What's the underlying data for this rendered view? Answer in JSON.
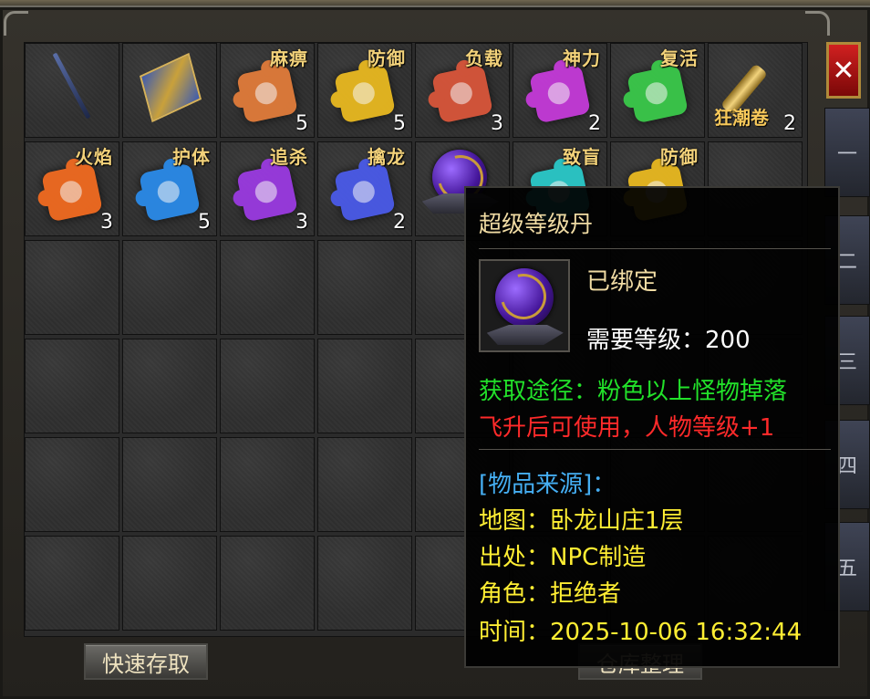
{
  "window": {
    "close_label": "✕"
  },
  "inventory": {
    "slots": [
      {
        "kind": "sword",
        "name": "sword-item",
        "label": "",
        "count": ""
      },
      {
        "kind": "banner",
        "name": "banner-item",
        "label": "",
        "count": ""
      },
      {
        "kind": "piece",
        "name": "puzzle-paralysis",
        "label": "麻痹",
        "count": "5",
        "color": "#e07b3a"
      },
      {
        "kind": "piece",
        "name": "puzzle-defense",
        "label": "防御",
        "count": "5",
        "color": "#e8b820"
      },
      {
        "kind": "piece",
        "name": "puzzle-load",
        "label": "负载",
        "count": "3",
        "color": "#d8553a"
      },
      {
        "kind": "piece",
        "name": "puzzle-divine-power",
        "label": "神力",
        "count": "2",
        "color": "#c43ad8"
      },
      {
        "kind": "piece",
        "name": "puzzle-revive",
        "label": "复活",
        "count": "",
        "color": "#3ac84a"
      },
      {
        "kind": "scroll",
        "name": "frenzy-scroll",
        "label": "狂潮卷",
        "count": "2"
      },
      {
        "kind": "piece",
        "name": "puzzle-flame",
        "label": "火焰",
        "count": "3",
        "color": "#f06a20"
      },
      {
        "kind": "piece",
        "name": "puzzle-guard",
        "label": "护体",
        "count": "5",
        "color": "#2a8ae8"
      },
      {
        "kind": "piece",
        "name": "puzzle-pursuit",
        "label": "追杀",
        "count": "3",
        "color": "#9a3ae0"
      },
      {
        "kind": "piece",
        "name": "puzzle-dragon",
        "label": "擒龙",
        "count": "2",
        "color": "#4a5ae8"
      },
      {
        "kind": "orb",
        "name": "super-level-pill",
        "label": "",
        "count": ""
      },
      {
        "kind": "piece",
        "name": "puzzle-blind",
        "label": "致盲",
        "count": "",
        "color": "#2ac8c8"
      },
      {
        "kind": "piece",
        "name": "puzzle-defense-2",
        "label": "防御",
        "count": "",
        "color": "#e8b820"
      }
    ]
  },
  "buttons": {
    "quick_access": "快速存取",
    "sort_storage": "仓库整理"
  },
  "side_tabs": [
    "一",
    "二",
    "三",
    "四",
    "五"
  ],
  "tooltip": {
    "title": "超级等级丹",
    "bound": "已绑定",
    "level_req": "需要等级：200",
    "obtain": "获取途径：粉色以上怪物掉落",
    "usage": "飞升后可使用，人物等级+1",
    "source_header": "[物品来源]：",
    "map": "地图：卧龙山庄1层",
    "origin": "出处：NPC制造",
    "role": "角色：拒绝者",
    "time": "时间：2025-10-06 16:32:44"
  }
}
